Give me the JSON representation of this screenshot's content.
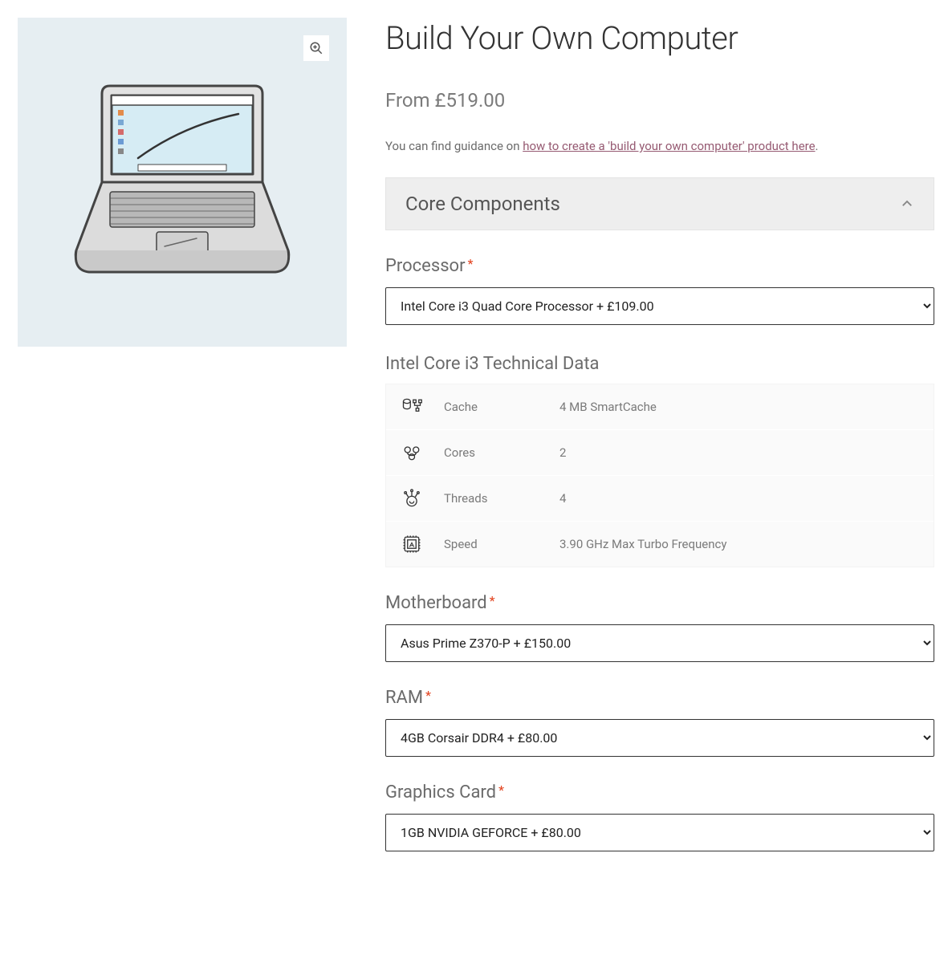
{
  "product": {
    "title": "Build Your Own Computer",
    "price_prefix": "From ",
    "price": "£519.00",
    "guidance_pre": "You can find guidance on ",
    "guidance_link": "how to create a 'build your own computer' product here",
    "guidance_post": "."
  },
  "accordion": {
    "title": "Core Components"
  },
  "fields": {
    "processor": {
      "label": "Processor",
      "selected": "Intel Core i3 Quad Core Processor + £109.00"
    },
    "motherboard": {
      "label": "Motherboard",
      "selected": "Asus Prime Z370-P + £150.00"
    },
    "ram": {
      "label": "RAM",
      "selected": "4GB Corsair DDR4 + £80.00"
    },
    "graphics": {
      "label": "Graphics Card",
      "selected": "1GB NVIDIA GEFORCE + £80.00"
    }
  },
  "tech": {
    "title": "Intel Core i3 Technical Data",
    "rows": [
      {
        "icon": "cache-icon",
        "key": "Cache",
        "val": "4 MB SmartCache"
      },
      {
        "icon": "cores-icon",
        "key": "Cores",
        "val": "2"
      },
      {
        "icon": "threads-icon",
        "key": "Threads",
        "val": "4"
      },
      {
        "icon": "speed-icon",
        "key": "Speed",
        "val": "3.90 GHz Max Turbo Frequency"
      }
    ]
  },
  "required_mark": "*"
}
